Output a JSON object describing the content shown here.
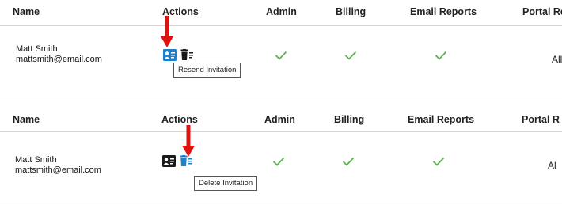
{
  "colors": {
    "check": "#5bb34e",
    "arrow": "#e0120f",
    "icon_active": "#1f7fc7",
    "icon_default": "#1a1a1a"
  },
  "panels": [
    {
      "headers": {
        "name": "Name",
        "actions": "Actions",
        "admin": "Admin",
        "billing": "Billing",
        "email_reports": "Email Reports",
        "portal": "Portal Re"
      },
      "row": {
        "name": "Matt Smith",
        "email": "mattsmith@email.com",
        "icons": [
          "resend-invitation-icon",
          "delete-invitation-icon"
        ],
        "portal_value": "All",
        "tooltip": "Resend Invitation"
      }
    },
    {
      "headers": {
        "name": "Name",
        "actions": "Actions",
        "admin": "Admin",
        "billing": "Billing",
        "email_reports": "Email Reports",
        "portal": "Portal R"
      },
      "row": {
        "name": "Matt Smith",
        "email": "mattsmith@email.com",
        "icons": [
          "resend-invitation-icon",
          "delete-invitation-icon"
        ],
        "portal_value": "Al",
        "tooltip": "Delete Invitation"
      }
    }
  ]
}
